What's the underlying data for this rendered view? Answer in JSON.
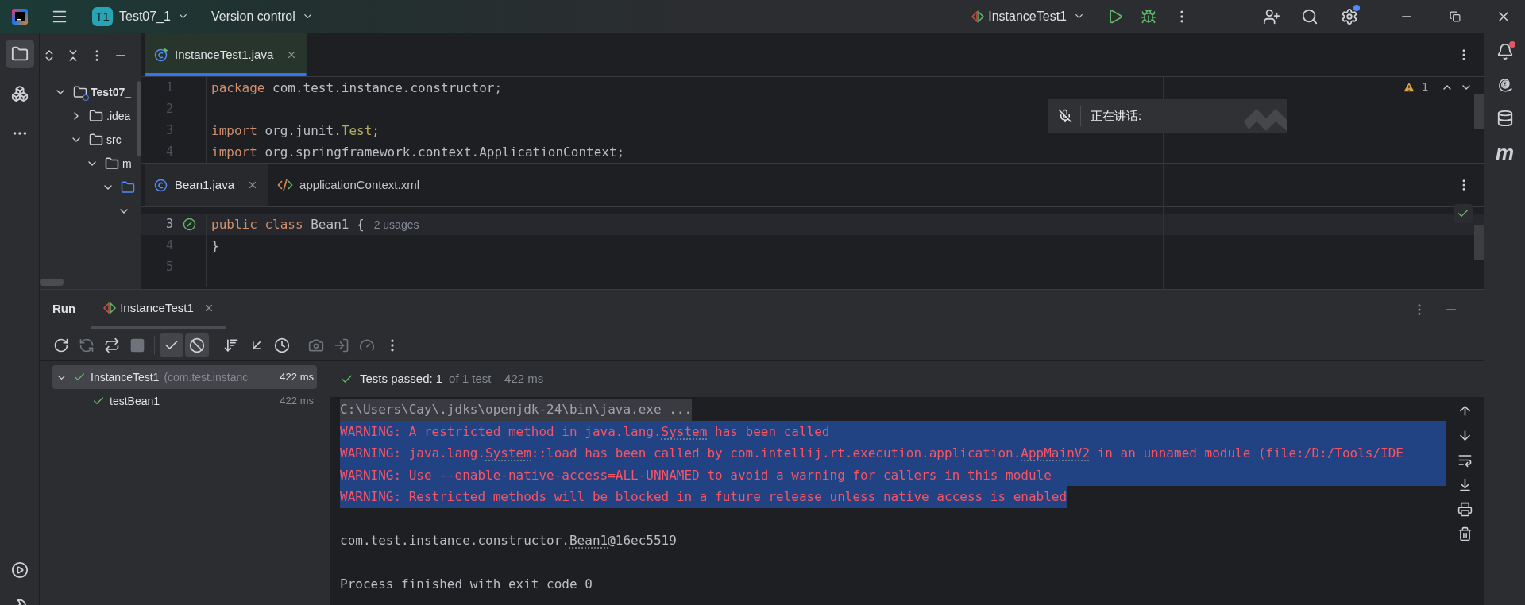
{
  "title_bar": {
    "project_badge": "T1",
    "project": "Test07_1",
    "vcs": "Version control",
    "run_config": "InstanceTest1",
    "settings_badge": true
  },
  "left_strip": {
    "top": [
      {
        "kind": "project",
        "selected": true
      },
      {
        "kind": "structure",
        "selected": false
      },
      {
        "kind": "more",
        "selected": false
      }
    ],
    "bottom": [
      {
        "kind": "run",
        "selected": false
      },
      {
        "kind": "build",
        "selected": false
      }
    ]
  },
  "project_tree": [
    {
      "kind": "module",
      "label": "Test07_",
      "expanded": true,
      "children": [
        {
          "kind": "folder",
          "label": ".idea",
          "expanded": false
        },
        {
          "kind": "folder",
          "label": "src",
          "expanded": true,
          "children": [
            {
              "kind": "folder",
              "label": "m",
              "expanded": true,
              "children": [
                {
                  "kind": "package",
                  "expanded": true,
                  "children": [
                    {
                      "expanded": true
                    }
                  ]
                }
              ]
            }
          ]
        }
      ]
    }
  ],
  "editor": {
    "panes": [
      {
        "focused": true,
        "inspection": {
          "kind": "warning",
          "count": "1"
        },
        "tabs": [
          {
            "kind": "test-class",
            "label": "InstanceTest1.java",
            "selected": true
          }
        ],
        "lines": [
          {
            "number": "1",
            "current": false,
            "parts": [
              {
                "kind": "keyword",
                "text": "package"
              },
              {
                "kind": "plain",
                "text": " com.test.instance.constructor;"
              }
            ]
          },
          {
            "number": "2",
            "current": false
          },
          {
            "number": "3",
            "current": false,
            "parts": [
              {
                "kind": "keyword",
                "text": "import"
              },
              {
                "kind": "plain",
                "text": " org.junit."
              },
              {
                "kind": "type",
                "text": "Test"
              },
              {
                "kind": "plain",
                "text": ";"
              }
            ]
          },
          {
            "number": "4",
            "current": false,
            "parts": [
              {
                "kind": "keyword",
                "text": "import"
              },
              {
                "kind": "plain",
                "text": " org.springframework.context.ApplicationContext;"
              }
            ]
          }
        ]
      },
      {
        "focused": false,
        "inspection": {
          "kind": "ok"
        },
        "tabs": [
          {
            "kind": "class",
            "label": "Bean1.java",
            "selected": true
          },
          {
            "kind": "xml",
            "label": "applicationContext.xml",
            "selected": false
          }
        ],
        "lines": [
          {
            "number": "3",
            "current": true,
            "gutter_marker": true,
            "parts": [
              {
                "kind": "keyword",
                "text": "public class"
              },
              {
                "kind": "plain",
                "text": " Bean1 {"
              },
              {
                "kind": "hint",
                "text": "2 usages"
              }
            ]
          },
          {
            "number": "4",
            "current": false,
            "parts": [
              {
                "kind": "plain",
                "text": "}"
              }
            ]
          },
          {
            "number": "5",
            "current": false
          }
        ]
      }
    ]
  },
  "speaking_popup": {
    "label": "正在讲话:",
    "muted": true
  },
  "run_panel": {
    "title": "Run",
    "tabs": [
      {
        "label": "InstanceTest1",
        "selected": true
      }
    ],
    "toolbar": [
      {
        "kind": "rerun",
        "disabled": false,
        "toggled": false
      },
      {
        "kind": "rerun-failed",
        "disabled": true,
        "toggled": false
      },
      {
        "kind": "auto-rerun",
        "disabled": false,
        "toggled": false
      },
      {
        "kind": "stop",
        "disabled": true,
        "toggled": false
      },
      {
        "kind": "separator"
      },
      {
        "kind": "show-passed",
        "disabled": false,
        "toggled": true
      },
      {
        "kind": "show-ignored",
        "disabled": false,
        "toggled": true
      },
      {
        "kind": "separator"
      },
      {
        "kind": "sort",
        "disabled": false,
        "toggled": false
      },
      {
        "kind": "import",
        "disabled": false,
        "toggled": false
      },
      {
        "kind": "history",
        "disabled": false,
        "toggled": false
      },
      {
        "kind": "separator"
      },
      {
        "kind": "screenshot",
        "disabled": true,
        "toggled": false
      },
      {
        "kind": "export",
        "disabled": true,
        "toggled": false
      },
      {
        "kind": "coverage",
        "disabled": true,
        "toggled": false
      },
      {
        "kind": "more",
        "disabled": false,
        "toggled": false
      }
    ],
    "tests": [
      {
        "name": "InstanceTest1",
        "detail": "(com.test.instanc",
        "time": "422 ms",
        "passed": true,
        "selected": true,
        "expanded": true,
        "children": [
          {
            "name": "testBean1",
            "time": "422 ms",
            "passed": true,
            "selected": false
          }
        ]
      }
    ],
    "status": {
      "label": "Tests passed:",
      "count": "1",
      "detail": "of 1 test – 422 ms",
      "passed": true
    },
    "console": [
      {
        "kind": "command",
        "selected": false,
        "parts": [
          {
            "text": "C:\\Users\\Cay\\.jdks\\openjdk-24\\bin\\java.exe ..."
          }
        ]
      },
      {
        "kind": "stderr",
        "selected": true,
        "full_line": true,
        "parts": [
          {
            "text": "WARNING: A restricted method in java.lang."
          },
          {
            "text": "System",
            "link": true
          },
          {
            "text": " has been called"
          }
        ]
      },
      {
        "kind": "stderr",
        "selected": true,
        "full_line": true,
        "parts": [
          {
            "text": "WARNING: java.lang."
          },
          {
            "text": "System",
            "link": true
          },
          {
            "text": "::load has been called by com.intellij.rt.execution.application."
          },
          {
            "text": "AppMainV2",
            "link": true
          },
          {
            "text": " in an unnamed module (file:/D:/Tools/IDE"
          }
        ]
      },
      {
        "kind": "stderr",
        "selected": true,
        "full_line": true,
        "parts": [
          {
            "text": "WARNING: Use --enable-native-access=ALL-UNNAMED to avoid a warning for callers in this module"
          }
        ]
      },
      {
        "kind": "stderr",
        "selected": true,
        "full_line": false,
        "parts": [
          {
            "text": "WARNING: Restricted methods will be blocked in a future release unless native access is enabled"
          }
        ]
      },
      {
        "kind": "blank"
      },
      {
        "kind": "stdout",
        "selected": false,
        "parts": [
          {
            "text": "com.test.instance.constructor."
          },
          {
            "text": "Bean1",
            "link": true
          },
          {
            "text": "@16ec5519"
          }
        ]
      },
      {
        "kind": "blank"
      },
      {
        "kind": "stdout",
        "selected": false,
        "parts": [
          {
            "text": "Process finished with exit code 0"
          }
        ]
      }
    ],
    "console_tools": [
      {
        "kind": "up"
      },
      {
        "kind": "down"
      },
      {
        "kind": "wrap"
      },
      {
        "kind": "scroll-end"
      },
      {
        "kind": "print"
      },
      {
        "kind": "clear"
      }
    ]
  },
  "right_strip": [
    {
      "kind": "notifications",
      "badge": true
    },
    {
      "kind": "ai"
    },
    {
      "kind": "database"
    },
    {
      "kind": "glyph",
      "glyph": "m"
    }
  ]
}
